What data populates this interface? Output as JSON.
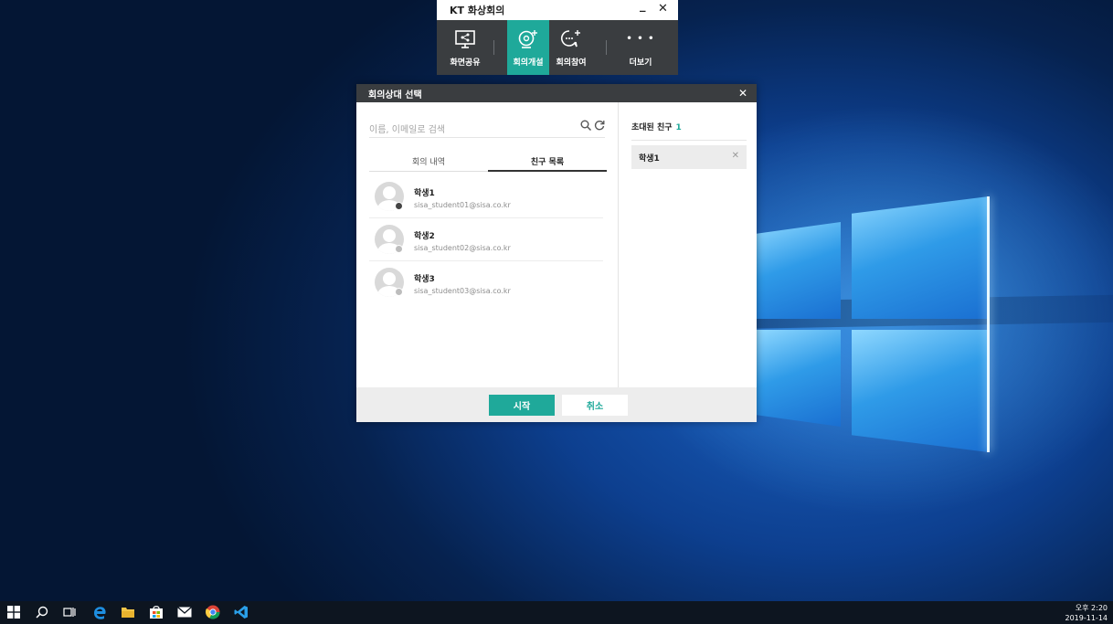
{
  "colors": {
    "accent": "#1fa99a",
    "titlebar": "#3a3d40",
    "online": "#444444",
    "offline": "#bdbdbd"
  },
  "kt_window": {
    "title": "KT 화상회의",
    "minimize": "_",
    "close": "✕",
    "buttons": [
      {
        "label": "화면공유",
        "icon": "screen-share-icon"
      },
      {
        "label": "회의개설",
        "icon": "create-meeting-icon",
        "active": true
      },
      {
        "label": "회의참여",
        "icon": "join-meeting-icon"
      },
      {
        "label": "더보기",
        "icon": "more-icon",
        "glyph": "• • •"
      }
    ]
  },
  "dialog": {
    "title": "회의상대 선택",
    "close": "✕",
    "search_placeholder": "이름, 이메일로 검색",
    "tabs": [
      {
        "label": "회의 내역"
      },
      {
        "label": "친구 목록",
        "selected": true
      }
    ],
    "friends": [
      {
        "name": "학생1",
        "email": "sisa_student01@sisa.co.kr",
        "online": true
      },
      {
        "name": "학생2",
        "email": "sisa_student02@sisa.co.kr",
        "online": false
      },
      {
        "name": "학생3",
        "email": "sisa_student03@sisa.co.kr",
        "online": false
      }
    ],
    "invited_label": "초대된 친구",
    "invited_count": "1",
    "invited": [
      {
        "name": "학생1",
        "remove": "✕"
      }
    ],
    "start_label": "시작",
    "cancel_label": "취소"
  },
  "taskbar": {
    "time": "오후 2:20",
    "date": "2019-11-14",
    "icons": [
      "windows-start-icon",
      "search-icon",
      "task-view-icon",
      "edge-icon",
      "file-explorer-icon",
      "store-icon",
      "mail-icon",
      "chrome-icon",
      "vscode-icon"
    ]
  }
}
